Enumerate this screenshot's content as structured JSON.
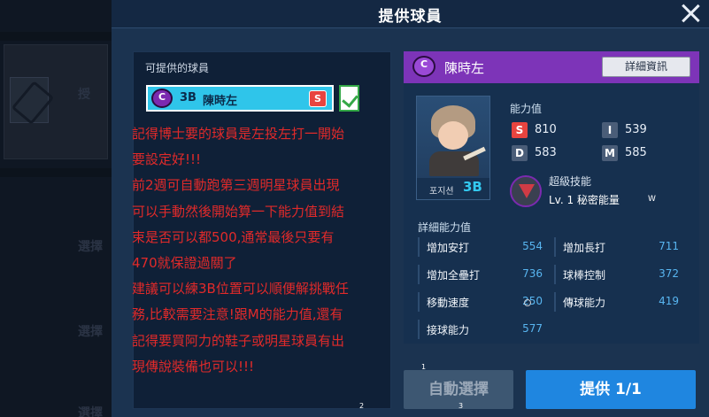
{
  "background": {
    "faded_labels": [
      "授",
      "選擇",
      "選擇",
      "選擇"
    ]
  },
  "modal": {
    "title": "提供球員",
    "available_label": "可提供的球員",
    "selected_player": {
      "badge": "C",
      "position": "3B",
      "name": "陳時左",
      "tag": "S"
    },
    "note_lines": [
      "記得博士要的球員是左投左打一開始",
      "要設定好!!!",
      "前2週可自動跑第三週明星球員出現",
      "可以手動然後開始算一下能力值到結",
      "束是否可以都500,通常最後只要有",
      "470就保證過關了",
      "建議可以練3B位置可以順便解挑戰任",
      "務,比較需要注意!跟M的能力值,還有",
      "記得要買阿力的鞋子或明星球員有出",
      "現傳說裝備也可以!!!"
    ]
  },
  "player_panel": {
    "badge": "C",
    "name": "陳時左",
    "detail_button": "詳細資訊",
    "position_label": "포지션",
    "position_value": "3B",
    "ability_title": "能力值",
    "stats": [
      {
        "key": "S",
        "value": "810",
        "color": "#e8443f"
      },
      {
        "key": "I",
        "value": "539",
        "color": "#4a5d78"
      },
      {
        "key": "D",
        "value": "583",
        "color": "#4a5d78"
      },
      {
        "key": "M",
        "value": "585",
        "color": "#4a5d78"
      }
    ],
    "skill": {
      "name": "超級技能",
      "level": "Lv. 1 秘密能量",
      "mark": "W"
    },
    "detail_title": "詳細能力值",
    "detail_stats": [
      {
        "label": "增加安打",
        "value": "554"
      },
      {
        "label": "增加長打",
        "value": "711"
      },
      {
        "label": "增加全壘打",
        "value": "736"
      },
      {
        "label": "球棒控制",
        "value": "372"
      },
      {
        "label": "移動速度",
        "value": "250"
      },
      {
        "label": "傳球能力",
        "value": "419"
      },
      {
        "label": "接球能力",
        "value": "577"
      }
    ]
  },
  "buttons": {
    "auto_select": "自動選擇",
    "provide": "提供 1/1"
  },
  "markers": [
    "1",
    "2",
    "3"
  ]
}
